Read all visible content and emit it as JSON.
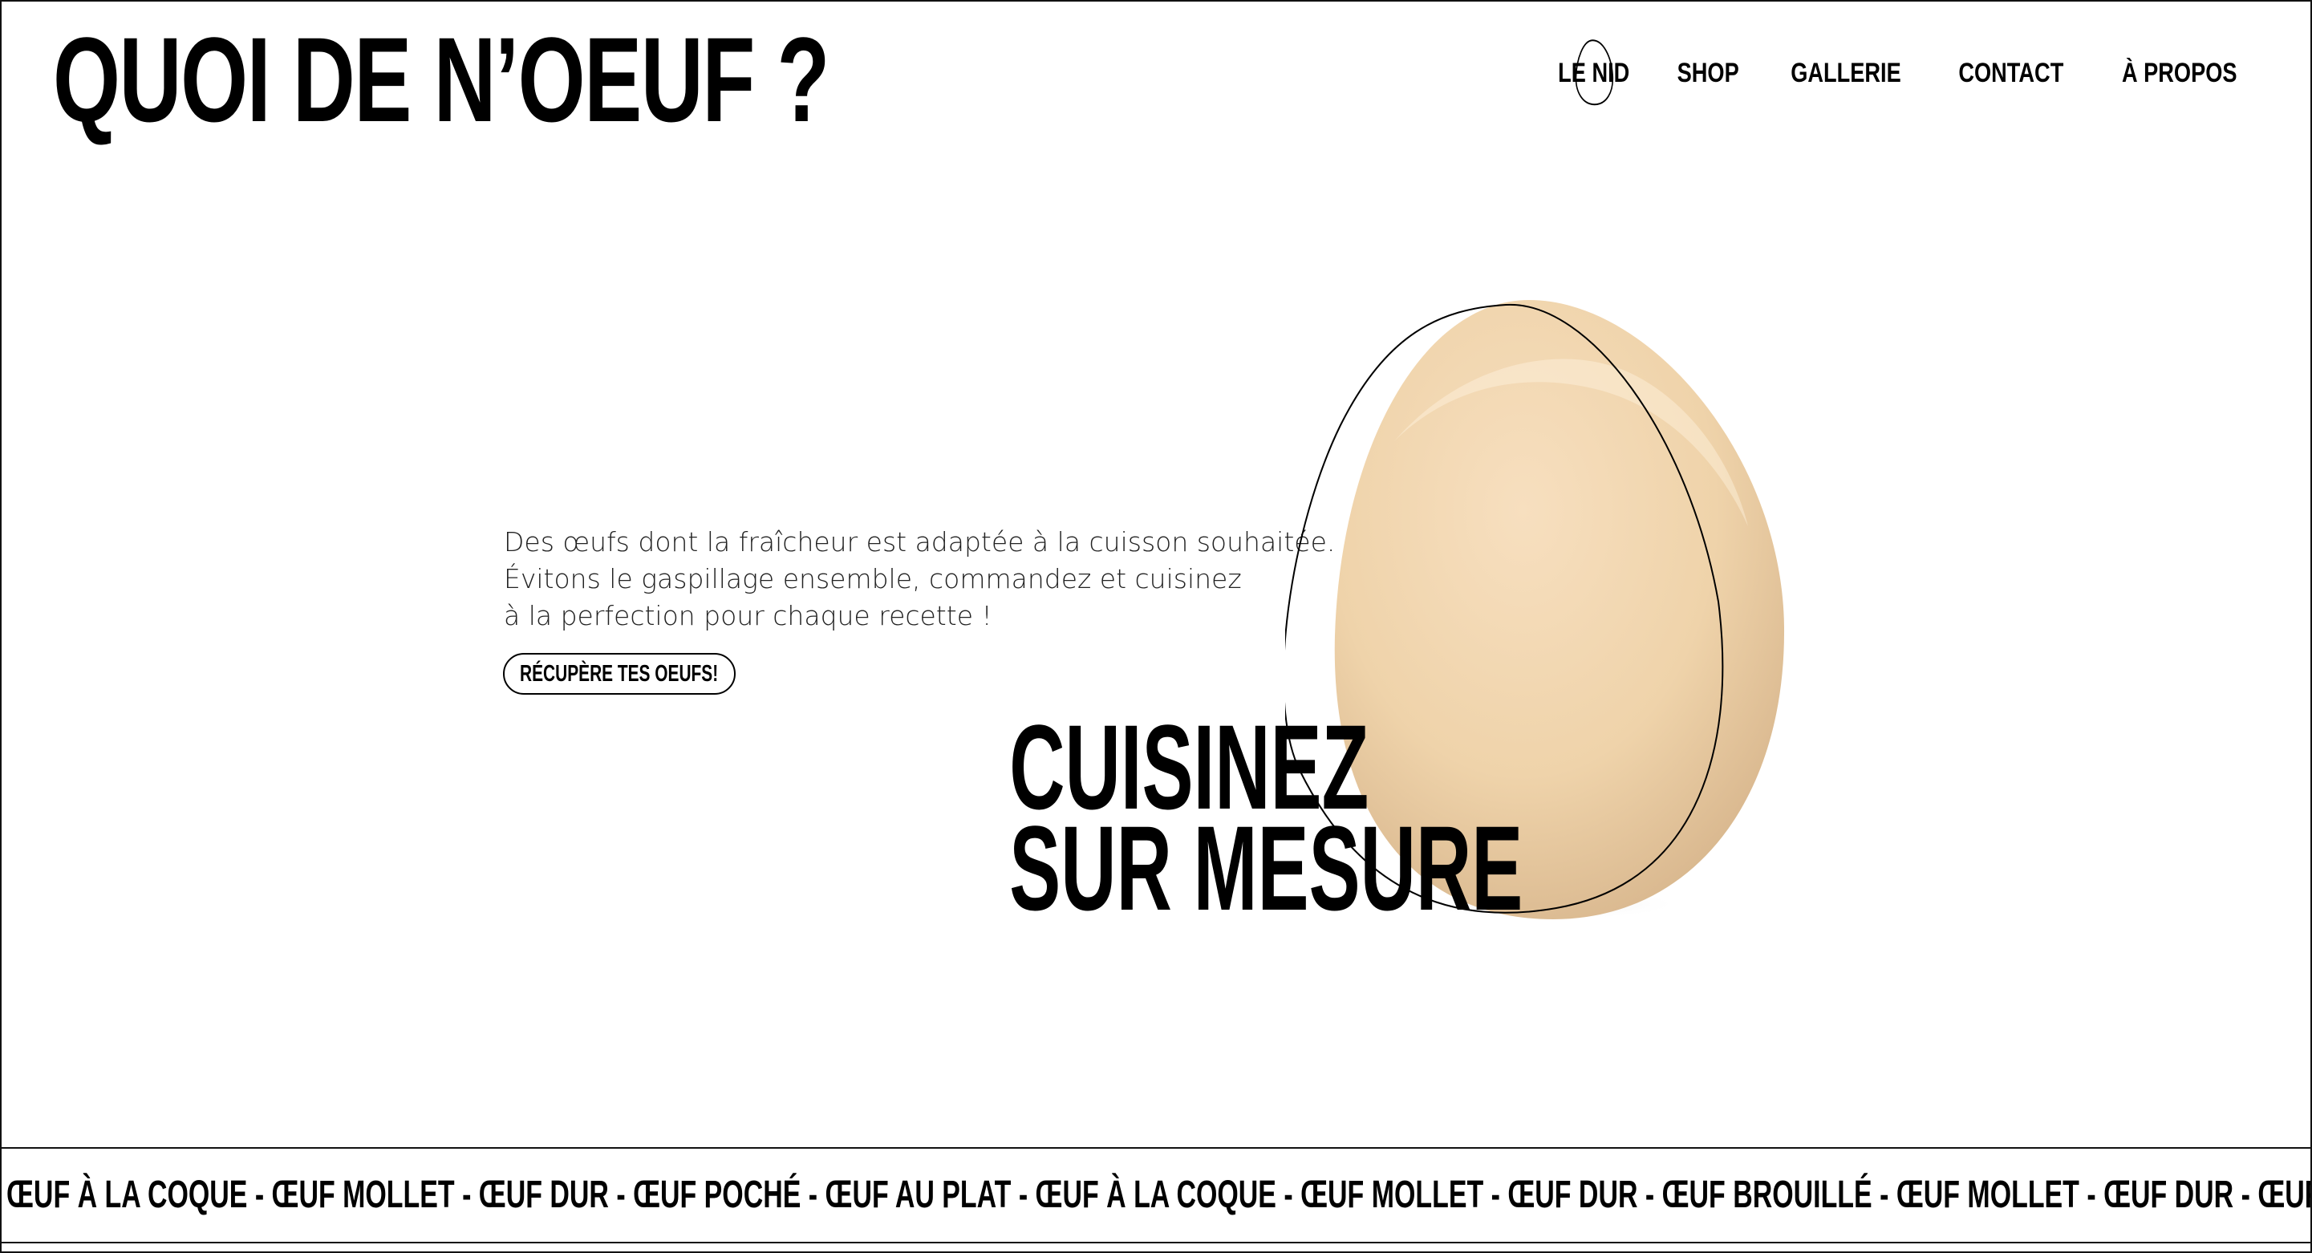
{
  "header": {
    "logo_text": "QUOI DE N’OEUF ?",
    "nav": [
      {
        "label": "LE NID",
        "active": true
      },
      {
        "label": "SHOP",
        "active": false
      },
      {
        "label": "GALLERIE",
        "active": false
      },
      {
        "label": "CONTACT",
        "active": false
      },
      {
        "label": "À PROPOS",
        "active": false
      }
    ]
  },
  "hero": {
    "copy_lines": [
      "Des œufs dont la fraîcheur est adaptée à la cuisson souhaitée.",
      "Évitons le gaspillage ensemble, commandez et cuisinez",
      "à la perfection pour chaque recette !"
    ],
    "cta_label": "RÉCUPÈRE TES OEUFS!",
    "headline_lines": [
      "CUISINEZ",
      "SUR MESURE"
    ],
    "image_icon": "egg-icon"
  },
  "marquee": {
    "text": "ŒUF À LA COQUE - ŒUF MOLLET - ŒUF DUR - ŒUF POCHÉ - ŒUF AU PLAT - ŒUF À LA COQUE - ŒUF MOLLET - ŒUF DUR  - ŒUF BROUILLÉ - ŒUF MOLLET - ŒUF DUR - ŒUF POCHÉ - ŒUF AU PLAT -"
  },
  "colors": {
    "text": "#000000",
    "background": "#ffffff",
    "egg": "#efd2aa"
  }
}
